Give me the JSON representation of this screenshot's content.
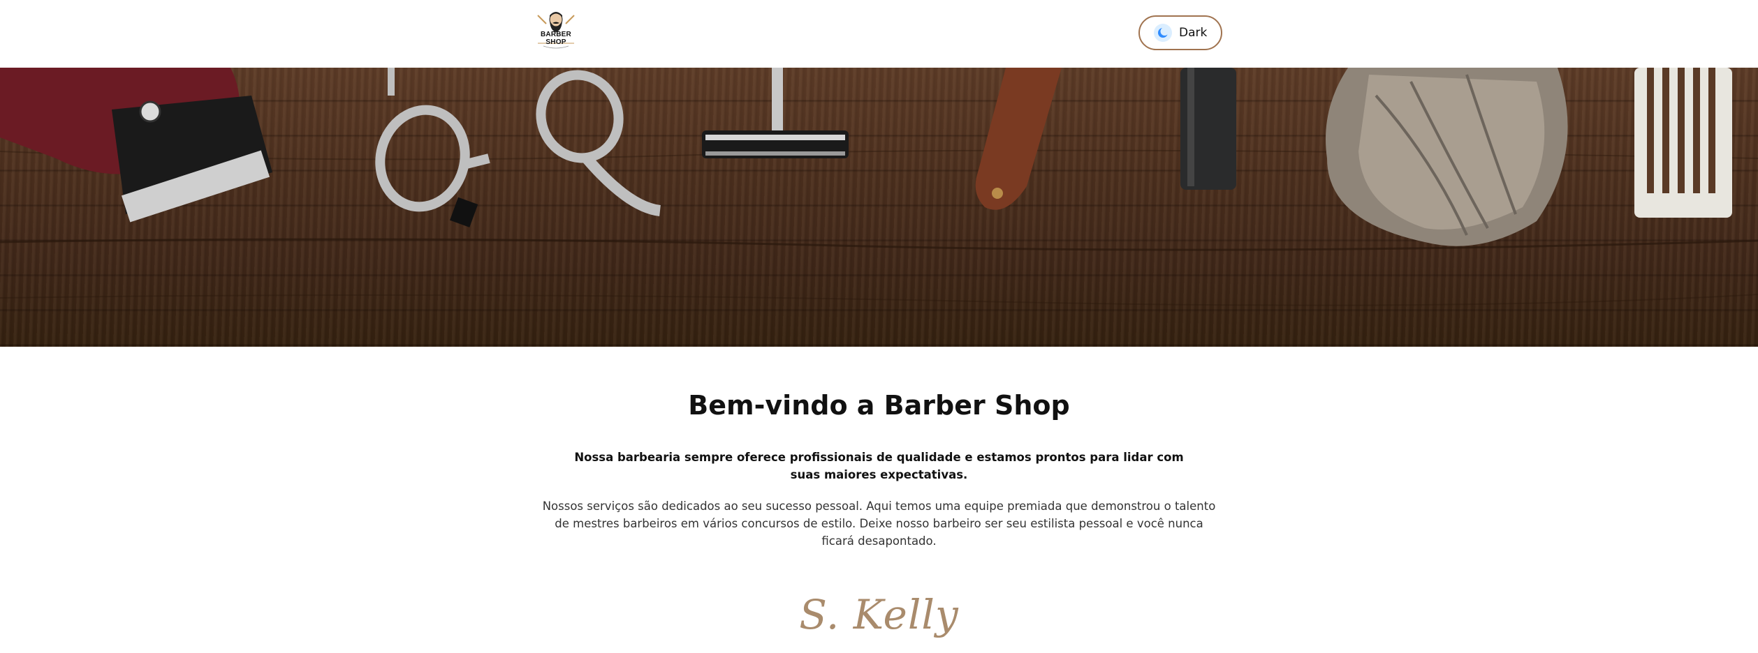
{
  "header": {
    "logo_text": "BARBER SHOP",
    "theme_toggle": {
      "label": "Dark",
      "icon": "moon-icon"
    }
  },
  "hero": {
    "description": "",
    "icons": [
      "hair-clipper-icon",
      "scissors-icon",
      "razor-icon",
      "straight-razor-icon",
      "shaving-brush-icon",
      "comb-icon"
    ]
  },
  "content": {
    "title": "Bem-vindo a Barber Shop",
    "lead": "Nossa barbearia sempre oferece profissionais de qualidade e estamos prontos para lidar com suas maiores expectativas.",
    "body": "Nossos serviços são dedicados ao seu sucesso pessoal. Aqui temos uma equipe premiada que demonstrou o talento de mestres barbeiros em vários concursos de estilo. Deixe nosso barbeiro ser seu estilista pessoal e você nunca ficará desapontado.",
    "signature": "S. Kelly"
  },
  "colors": {
    "accent": "#a0734f",
    "signature": "#a98b6c",
    "wood_dark": "#3e2618",
    "wood_light": "#5b3a26",
    "moon_blue": "#2f8cff"
  }
}
